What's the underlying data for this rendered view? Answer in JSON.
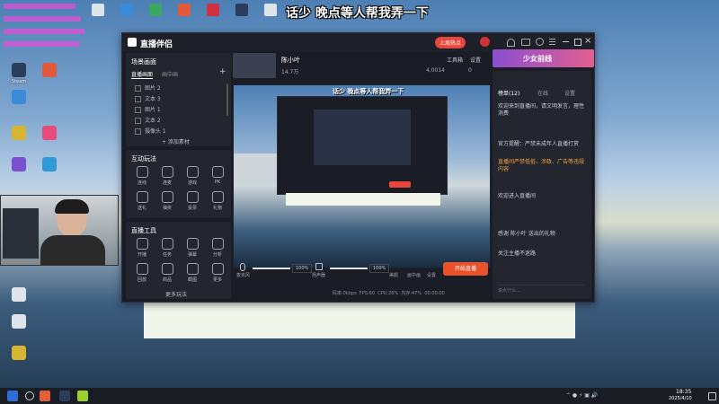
{
  "overlay_caption": "话少 晚点等人帮我弄一下",
  "desktop_icons": [
    {
      "label": "Steam",
      "color": "#2a3e5c"
    },
    {
      "label": "",
      "color": "#e15b3a"
    },
    {
      "label": "",
      "color": "#3a8bd8"
    },
    {
      "label": "",
      "color": "#d8b530"
    },
    {
      "label": "",
      "color": "#7a4fd0"
    },
    {
      "label": "",
      "color": "#2f9ad8"
    },
    {
      "label": "",
      "color": "#e74d7a"
    },
    {
      "label": "",
      "color": "#dfe3ea"
    },
    {
      "label": "",
      "color": "#3aa864"
    }
  ],
  "app": {
    "logo_text": "直播伴侣",
    "live_badge": "上周热点",
    "window_controls": [
      "minimize",
      "maximize",
      "close"
    ],
    "scene_section": {
      "title": "场景画面",
      "tabs": [
        "直播画面",
        "画中画"
      ],
      "add_label": "+",
      "items": [
        {
          "label": "图片 2",
          "checked": true
        },
        {
          "label": "文本 3",
          "checked": true
        },
        {
          "label": "图片 1",
          "checked": false
        },
        {
          "label": "文本 2",
          "checked": true
        },
        {
          "label": "摄像头 1",
          "checked": false
        }
      ],
      "add_source_label": "+ 添加素材"
    },
    "tools_section": {
      "title": "互动玩法",
      "tiles": [
        "连线",
        "连麦",
        "游戏",
        "PK",
        "送礼",
        "抽奖",
        "投票",
        "礼物"
      ]
    },
    "more_section": {
      "title": "直播工具",
      "tiles": [
        "开播",
        "任务",
        "弹幕",
        "分析",
        "回放",
        "商品",
        "截图",
        "更多"
      ],
      "expand_label": "更多玩法"
    },
    "stream_header": {
      "streamer": "陈小叶",
      "stats": [
        "14.7万",
        "4,0014",
        "0"
      ],
      "right_buttons": [
        "工具箱",
        "设置"
      ]
    },
    "banner_text": "少女前线",
    "preview_caption": "话少 晚点等人帮我弄一下",
    "audio": {
      "mic_label": "麦克风",
      "mic_value": "100%",
      "speaker_label": "扬声器",
      "speaker_value": "100%",
      "mic_level": 1.0,
      "speaker_level": 1.0
    },
    "bottom_tools": [
      "美颜",
      "画中画",
      "设置"
    ],
    "start_button": "开始直播",
    "status_bar": [
      "码率:0kbps",
      "FPS:60",
      "CPU:26%",
      "内存:47%",
      "00:00:00"
    ],
    "chat": {
      "tabs": [
        "榜单(12)",
        "在线",
        "设置"
      ],
      "messages": [
        "欢迎来到直播间，请文明发言，理性消费",
        "官方提醒：严禁未成年人直播打赏",
        "直播间严禁低俗、涉政、广告等违规内容",
        "欢迎进入直播间",
        "感谢 陈小叶 送出的礼物",
        "关注主播不迷路"
      ],
      "input_placeholder": "说点什么..."
    }
  },
  "taskbar": {
    "time": "18:35",
    "date": "2025/4/10"
  }
}
